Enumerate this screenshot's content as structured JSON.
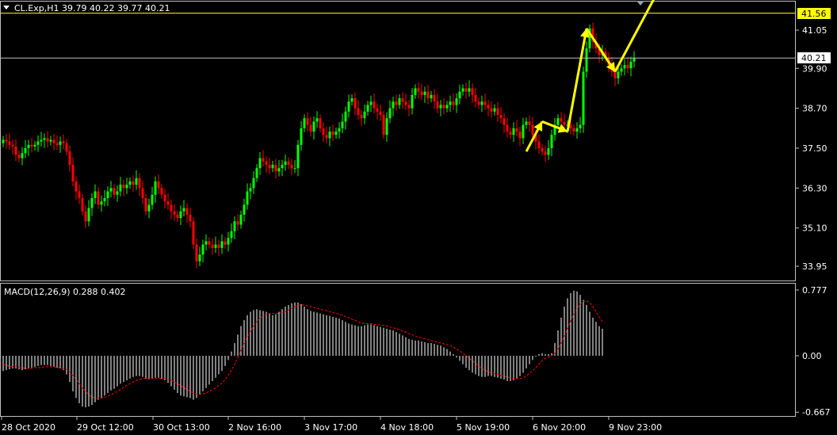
{
  "header": {
    "symbol_line": "CL.Exp,H1  39.79 40.22 39.77 40.21"
  },
  "colors": {
    "background": "#000000",
    "bull": "#00ff00",
    "bear": "#ff0000",
    "arrow": "#ffff00",
    "level_line": "#ffff00",
    "price_line": "#c0c0c0",
    "macd_hist": "#ffffff",
    "macd_signal": "#ff0000"
  },
  "price_panel": {
    "y_ticks": [
      "41.05",
      "39.90",
      "38.70",
      "37.50",
      "36.30",
      "35.10",
      "33.95"
    ],
    "level_label": "41.56",
    "current_label": "40.21"
  },
  "macd_panel": {
    "label": "MACD(12,26,9) 0.288 0.402",
    "y_ticks": [
      "0.777",
      "0.00",
      "-0.667"
    ]
  },
  "x_ticks": [
    "28 Oct 2020",
    "29 Oct 12:00",
    "30 Oct 13:00",
    "2 Nov 16:00",
    "3 Nov 17:00",
    "4 Nov 18:00",
    "5 Nov 19:00",
    "6 Nov 20:00",
    "9 Nov 23:00"
  ],
  "chart_data": {
    "type": "line",
    "title": "CL.Exp,H1",
    "ohlc_last": {
      "open": 39.79,
      "high": 40.22,
      "low": 39.77,
      "close": 40.21
    },
    "close_series": [
      37.75,
      37.7,
      37.6,
      37.55,
      37.3,
      37.2,
      37.35,
      37.5,
      37.6,
      37.55,
      37.6,
      37.7,
      37.75,
      37.8,
      37.7,
      37.75,
      37.65,
      37.6,
      37.7,
      37.65,
      37.4,
      37.0,
      36.5,
      36.2,
      36.0,
      35.6,
      35.3,
      35.7,
      36.0,
      36.2,
      35.8,
      35.9,
      36.0,
      36.2,
      36.3,
      36.1,
      36.2,
      36.4,
      36.3,
      36.4,
      36.5,
      36.4,
      36.6,
      36.3,
      36.0,
      35.6,
      35.8,
      36.1,
      36.5,
      36.3,
      36.1,
      35.9,
      35.8,
      35.6,
      35.5,
      35.4,
      35.6,
      35.7,
      35.5,
      35.3,
      34.6,
      34.1,
      34.3,
      34.6,
      34.7,
      34.6,
      34.5,
      34.6,
      34.5,
      34.7,
      34.6,
      34.8,
      35.0,
      35.3,
      35.2,
      35.5,
      35.8,
      36.2,
      36.3,
      36.6,
      36.9,
      37.2,
      37.1,
      37.0,
      36.9,
      37.0,
      36.8,
      36.9,
      37.0,
      37.1,
      37.0,
      36.9,
      36.9,
      37.6,
      38.1,
      38.4,
      38.2,
      38.0,
      38.3,
      38.4,
      38.1,
      37.9,
      37.8,
      38.0,
      37.9,
      38.0,
      38.1,
      38.3,
      38.6,
      38.9,
      39.0,
      38.7,
      38.5,
      38.4,
      38.6,
      38.8,
      38.9,
      38.7,
      38.6,
      38.5,
      37.9,
      38.4,
      38.7,
      38.9,
      38.8,
      39.0,
      38.9,
      38.8,
      38.7,
      39.1,
      39.3,
      39.2,
      39.1,
      39.2,
      39.0,
      39.1,
      38.9,
      38.7,
      38.8,
      38.7,
      38.8,
      38.9,
      38.8,
      39.0,
      39.2,
      39.3,
      39.2,
      39.3,
      39.1,
      38.9,
      38.8,
      38.9,
      38.8,
      38.7,
      38.6,
      38.7,
      38.5,
      38.4,
      38.2,
      38.0,
      37.9,
      38.1,
      38.0,
      37.8,
      38.2,
      38.3,
      38.2,
      37.9,
      37.7,
      37.5,
      37.4,
      37.3,
      37.5,
      37.9,
      38.2,
      38.4,
      38.3,
      38.2,
      38.2,
      38.1,
      38.0,
      38.1,
      38.2,
      39.8,
      40.5,
      41.1,
      40.7,
      40.5,
      40.3,
      40.4,
      40.2,
      40.0,
      39.8,
      39.6,
      39.8,
      39.9,
      40.0,
      39.9,
      40.1,
      40.21
    ],
    "macd_hist": [
      -0.18,
      -0.17,
      -0.16,
      -0.15,
      -0.15,
      -0.16,
      -0.17,
      -0.16,
      -0.15,
      -0.14,
      -0.13,
      -0.12,
      -0.11,
      -0.11,
      -0.11,
      -0.12,
      -0.13,
      -0.14,
      -0.15,
      -0.17,
      -0.22,
      -0.31,
      -0.42,
      -0.5,
      -0.56,
      -0.6,
      -0.61,
      -0.6,
      -0.58,
      -0.55,
      -0.52,
      -0.5,
      -0.47,
      -0.44,
      -0.41,
      -0.39,
      -0.36,
      -0.33,
      -0.31,
      -0.29,
      -0.27,
      -0.25,
      -0.24,
      -0.24,
      -0.25,
      -0.27,
      -0.28,
      -0.27,
      -0.26,
      -0.26,
      -0.27,
      -0.29,
      -0.32,
      -0.36,
      -0.4,
      -0.44,
      -0.47,
      -0.48,
      -0.49,
      -0.5,
      -0.52,
      -0.5,
      -0.46,
      -0.42,
      -0.38,
      -0.34,
      -0.3,
      -0.26,
      -0.22,
      -0.18,
      -0.12,
      -0.05,
      0.05,
      0.15,
      0.25,
      0.35,
      0.42,
      0.48,
      0.52,
      0.54,
      0.55,
      0.54,
      0.53,
      0.52,
      0.5,
      0.48,
      0.49,
      0.52,
      0.55,
      0.58,
      0.6,
      0.62,
      0.63,
      0.63,
      0.61,
      0.58,
      0.55,
      0.53,
      0.52,
      0.51,
      0.5,
      0.49,
      0.48,
      0.47,
      0.46,
      0.45,
      0.44,
      0.42,
      0.4,
      0.38,
      0.37,
      0.36,
      0.35,
      0.35,
      0.36,
      0.37,
      0.37,
      0.36,
      0.35,
      0.34,
      0.33,
      0.32,
      0.31,
      0.3,
      0.28,
      0.26,
      0.24,
      0.22,
      0.2,
      0.19,
      0.18,
      0.18,
      0.17,
      0.16,
      0.15,
      0.15,
      0.14,
      0.13,
      0.12,
      0.1,
      0.08,
      0.05,
      0.02,
      -0.02,
      -0.06,
      -0.1,
      -0.14,
      -0.17,
      -0.2,
      -0.22,
      -0.24,
      -0.25,
      -0.25,
      -0.24,
      -0.24,
      -0.25,
      -0.26,
      -0.27,
      -0.28,
      -0.3,
      -0.3,
      -0.29,
      -0.27,
      -0.24,
      -0.2,
      -0.15,
      -0.1,
      -0.05,
      -0.01,
      0.02,
      0.03,
      0.02,
      0.02,
      0.03,
      0.15,
      0.3,
      0.45,
      0.58,
      0.68,
      0.74,
      0.77,
      0.76,
      0.72,
      0.66,
      0.6,
      0.52,
      0.45,
      0.4,
      0.35,
      0.32
    ],
    "macd_signal": [
      -0.1,
      -0.11,
      -0.12,
      -0.13,
      -0.13,
      -0.14,
      -0.14,
      -0.15,
      -0.15,
      -0.15,
      -0.14,
      -0.14,
      -0.14,
      -0.13,
      -0.13,
      -0.13,
      -0.13,
      -0.14,
      -0.14,
      -0.15,
      -0.16,
      -0.19,
      -0.23,
      -0.28,
      -0.33,
      -0.38,
      -0.42,
      -0.46,
      -0.49,
      -0.5,
      -0.5,
      -0.5,
      -0.49,
      -0.48,
      -0.46,
      -0.44,
      -0.42,
      -0.4,
      -0.37,
      -0.35,
      -0.33,
      -0.31,
      -0.29,
      -0.28,
      -0.27,
      -0.27,
      -0.27,
      -0.27,
      -0.27,
      -0.27,
      -0.27,
      -0.27,
      -0.28,
      -0.29,
      -0.31,
      -0.33,
      -0.35,
      -0.38,
      -0.4,
      -0.42,
      -0.44,
      -0.45,
      -0.45,
      -0.45,
      -0.44,
      -0.42,
      -0.4,
      -0.38,
      -0.35,
      -0.32,
      -0.28,
      -0.23,
      -0.17,
      -0.1,
      -0.02,
      0.06,
      0.14,
      0.22,
      0.29,
      0.35,
      0.4,
      0.44,
      0.47,
      0.49,
      0.5,
      0.5,
      0.5,
      0.5,
      0.51,
      0.52,
      0.54,
      0.56,
      0.58,
      0.6,
      0.6,
      0.6,
      0.59,
      0.58,
      0.57,
      0.56,
      0.55,
      0.54,
      0.53,
      0.52,
      0.51,
      0.5,
      0.49,
      0.48,
      0.46,
      0.45,
      0.43,
      0.42,
      0.4,
      0.39,
      0.38,
      0.38,
      0.38,
      0.37,
      0.37,
      0.36,
      0.36,
      0.35,
      0.34,
      0.33,
      0.32,
      0.31,
      0.29,
      0.28,
      0.26,
      0.25,
      0.23,
      0.22,
      0.21,
      0.2,
      0.19,
      0.18,
      0.17,
      0.16,
      0.15,
      0.14,
      0.13,
      0.12,
      0.1,
      0.08,
      0.06,
      0.03,
      0.0,
      -0.03,
      -0.06,
      -0.09,
      -0.12,
      -0.15,
      -0.17,
      -0.19,
      -0.2,
      -0.21,
      -0.22,
      -0.23,
      -0.24,
      -0.25,
      -0.26,
      -0.27,
      -0.27,
      -0.27,
      -0.26,
      -0.24,
      -0.21,
      -0.18,
      -0.14,
      -0.1,
      -0.06,
      -0.03,
      -0.01,
      0.0,
      0.03,
      0.08,
      0.15,
      0.23,
      0.32,
      0.41,
      0.49,
      0.56,
      0.61,
      0.64,
      0.65,
      0.63,
      0.58,
      0.52,
      0.46,
      0.4
    ],
    "arrows": [
      {
        "from": [
          165,
          37.4
        ],
        "to": [
          170,
          38.3
        ]
      },
      {
        "from": [
          170,
          38.3
        ],
        "to": [
          178,
          38.0
        ]
      },
      {
        "from": [
          178,
          38.0
        ],
        "to": [
          184,
          41.1
        ]
      },
      {
        "from": [
          184,
          41.1
        ],
        "to": [
          193,
          39.8
        ]
      },
      {
        "from": [
          193,
          39.8
        ],
        "to": [
          207,
          42.3
        ]
      }
    ],
    "ylim": [
      33.7,
      42.3
    ],
    "macd_ylim": [
      -0.72,
      0.82
    ]
  }
}
